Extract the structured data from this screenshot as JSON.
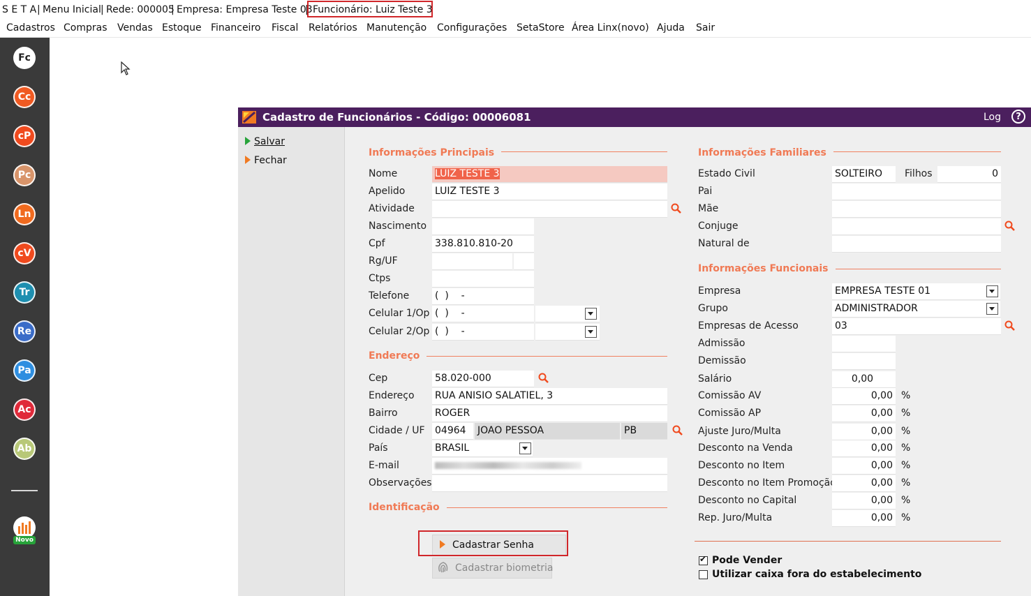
{
  "titlebar": {
    "segments": [
      "S E T A",
      "|",
      "Menu Inicial",
      "|",
      "Rede: 000005",
      "|",
      "Empresa: Empresa Teste  03",
      "|"
    ],
    "funcionario": "Funcionário: Luiz Teste 3"
  },
  "menubar": {
    "items": [
      "Cadastros",
      "Compras",
      "Vendas",
      "Estoque",
      "Financeiro",
      "Fiscal",
      "Relatórios",
      "Manutenção",
      "Configurações",
      "SetaStore",
      "Área Linx(novo)",
      "Ajuda",
      "Sair"
    ]
  },
  "sidebar": {
    "icons": [
      {
        "label": "Fc",
        "color": "#ffffff",
        "text_color": "#222222"
      },
      {
        "label": "Cc",
        "color": "#f05a22"
      },
      {
        "label": "cP",
        "color": "#f04a1e"
      },
      {
        "label": "Pc",
        "color": "#d8946a"
      },
      {
        "label": "Ln",
        "color": "#f06a1e"
      },
      {
        "label": "cV",
        "color": "#f04a1e"
      },
      {
        "label": "Tr",
        "color": "#1e8fb0"
      },
      {
        "label": "Re",
        "color": "#3a6cc8"
      },
      {
        "label": "Pa",
        "color": "#2e8ee0"
      },
      {
        "label": "Ac",
        "color": "#e02a3a"
      },
      {
        "label": "Ab",
        "color": "#b8c878"
      }
    ],
    "novo_label": "Novo"
  },
  "dialog": {
    "title": "Cadastro de Funcionários - Código: 00006081",
    "log": "Log",
    "help": "?",
    "actions": {
      "salvar": "Salvar",
      "fechar": "Fechar"
    },
    "principais": {
      "title": "Informações Principais",
      "nome_label": "Nome",
      "nome": "LUIZ TESTE 3",
      "apelido_label": "Apelido",
      "apelido": "LUIZ TESTE 3",
      "atividade_label": "Atividade",
      "atividade": "",
      "nascimento_label": "Nascimento",
      "nascimento": "",
      "cpf_label": "Cpf",
      "cpf": "338.810.810-20",
      "rg_label": "Rg/UF",
      "rg": "",
      "ctps_label": "Ctps",
      "ctps": "",
      "telefone_label": "Telefone",
      "telefone": "(  )    -",
      "celular1_label": "Celular 1/Op",
      "celular1": "(  )    -",
      "celular2_label": "Celular 2/Op",
      "celular2": "(  )    -"
    },
    "endereco": {
      "title": "Endereço",
      "cep_label": "Cep",
      "cep": "58.020-000",
      "endereco_label": "Endereço",
      "endereco": "RUA ANISIO SALATIEL, 3",
      "bairro_label": "Bairro",
      "bairro": "ROGER",
      "cidade_label": "Cidade / UF",
      "cidade_cod": "04964",
      "cidade": "JOAO PESSOA",
      "uf": "PB",
      "pais_label": "País",
      "pais": "BRASIL",
      "email_label": "E-mail",
      "obs_label": "Observações",
      "obs": ""
    },
    "identificacao": {
      "title": "Identificação",
      "cadastrar_senha": "Cadastrar Senha",
      "cadastrar_biometria": "Cadastrar biometria"
    },
    "familiares": {
      "title": "Informações Familiares",
      "estado_civil_label": "Estado Civil",
      "estado_civil": "SOLTEIRO",
      "filhos_label": "Filhos",
      "filhos": "0",
      "pai_label": "Pai",
      "mae_label": "Mãe",
      "conjuge_label": "Conjuge",
      "natural_label": "Natural de"
    },
    "funcionais": {
      "title": "Informações Funcionais",
      "empresa_label": "Empresa",
      "empresa": "EMPRESA TESTE  01",
      "grupo_label": "Grupo",
      "grupo": "ADMINISTRADOR",
      "acesso_label": "Empresas de Acesso",
      "acesso": "03",
      "admissao_label": "Admissão",
      "demissao_label": "Demissão",
      "salario_label": "Salário",
      "salario": "0,00",
      "percent_rows": [
        {
          "label": "Comissão AV",
          "value": "0,00"
        },
        {
          "label": "Comissão AP",
          "value": "0,00"
        },
        {
          "label": "Ajuste Juro/Multa",
          "value": "0,00"
        },
        {
          "label": "Desconto na Venda",
          "value": "0,00"
        },
        {
          "label": "Desconto no Item",
          "value": "0,00"
        },
        {
          "label": "Desconto no Item Promoção",
          "value": "0,00"
        },
        {
          "label": "Desconto no Capital",
          "value": "0,00"
        },
        {
          "label": "Rep. Juro/Multa",
          "value": "0,00"
        }
      ],
      "pct_symbol": "%"
    },
    "checkboxes": {
      "pode_vender": "Pode Vender",
      "pode_vender_checked": true,
      "caixa_fora": "Utilizar caixa fora do estabelecimento",
      "caixa_fora_checked": false
    }
  }
}
